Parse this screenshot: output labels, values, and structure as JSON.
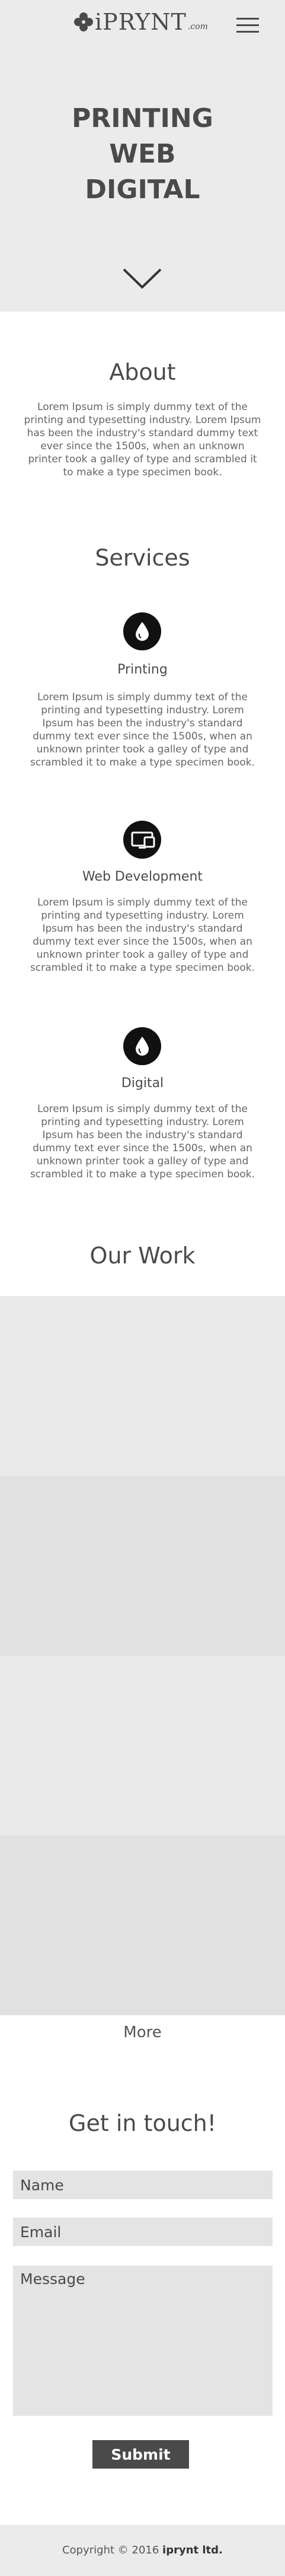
{
  "header": {
    "logo_text": "iPRYNT",
    "logo_suffix": ".com",
    "menu_icon": "hamburger-menu-icon"
  },
  "hero": {
    "title_lines": [
      "PRINTING",
      "WEB",
      "DIGITAL"
    ],
    "scroll_icon": "chevron-down-icon",
    "background": "#ebebeb"
  },
  "about": {
    "title": "About",
    "text": "Lorem Ipsum is simply dummy text of the printing and typesetting industry. Lorem Ipsum has been the industry's standard dummy text ever since the 1500s, when an unknown printer took a galley of type and scrambled it to make a type specimen book."
  },
  "services": {
    "title": "Services",
    "items": [
      {
        "icon": "ink-drop-icon",
        "name": "Printing",
        "text": "Lorem Ipsum is simply dummy text of the printing and typesetting industry. Lorem Ipsum has been the industry's standard dummy text ever since the 1500s, when an unknown printer took a galley of type and scrambled it to make a type specimen book."
      },
      {
        "icon": "devices-icon",
        "name": "Web Development",
        "text": "Lorem Ipsum is simply dummy text of the printing and typesetting industry. Lorem Ipsum has been the industry's standard dummy text ever since the 1500s, when an unknown printer took a galley of type and scrambled it to make a type specimen book."
      },
      {
        "icon": "ink-drop-icon",
        "name": "Digital",
        "text": "Lorem Ipsum is simply dummy text of the printing and typesetting industry. Lorem Ipsum has been the industry's standard dummy text ever since the 1500s, when an unknown printer took a galley of type and scrambled it to make a type specimen book."
      }
    ]
  },
  "work": {
    "title": "Our Work",
    "tile_colors": [
      "#e9e9e9",
      "#e1e1e1",
      "#e9e9e9",
      "#e1e1e1"
    ],
    "more_label": "More"
  },
  "contact": {
    "title": "Get in touch!",
    "name_placeholder": "Name",
    "email_placeholder": "Email",
    "message_placeholder": "Message",
    "submit_label": "Submit"
  },
  "footer": {
    "prefix": "Copyright © 2016 ",
    "company": "iprynt ltd."
  }
}
